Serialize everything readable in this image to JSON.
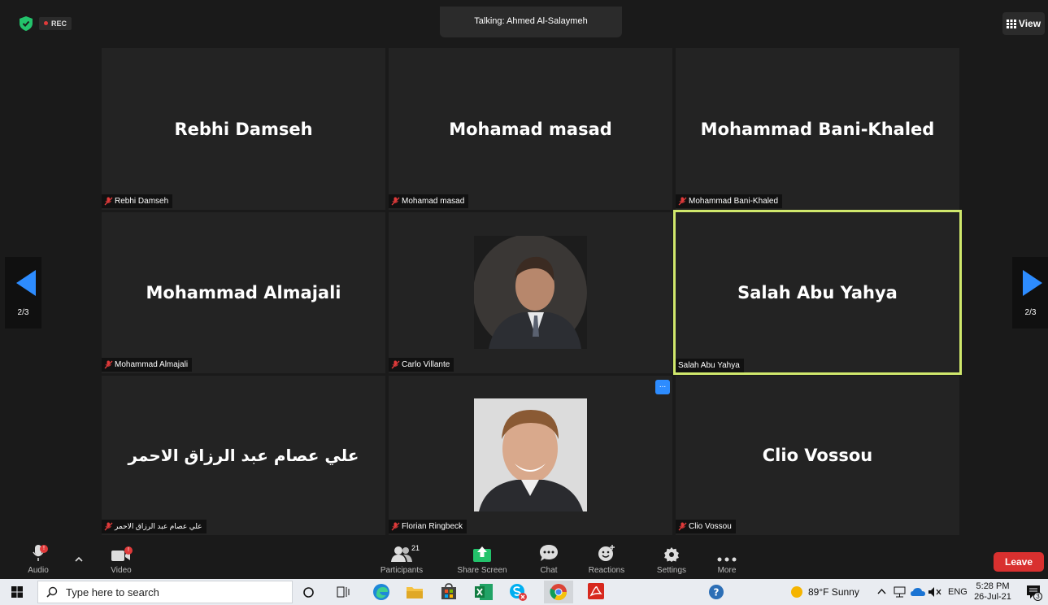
{
  "topbar": {
    "rec_label": "REC",
    "talking": "Talking: Ahmed Al-Salaymeh",
    "view_label": "View"
  },
  "tiles": [
    {
      "display_name": "Rebhi Damseh",
      "tag": "Rebhi Damseh",
      "muted": true
    },
    {
      "display_name": "Mohamad masad",
      "tag": "Mohamad masad",
      "muted": true
    },
    {
      "display_name": "Mohammad Bani-Khaled",
      "tag": "Mohammad Bani-Khaled",
      "muted": true
    },
    {
      "display_name": "Mohammad Almajali",
      "tag": "Mohammad Almajali",
      "muted": true
    },
    {
      "display_name": "",
      "tag": "Carlo Villante",
      "muted": true,
      "photo": true
    },
    {
      "display_name": "Salah Abu Yahya",
      "tag": "Salah Abu Yahya",
      "muted": false,
      "active": true
    },
    {
      "display_name": "علي عصام عبد الرزاق الاحمر",
      "tag": "علي عصام عبد الرزاق الاحمر",
      "muted": true
    },
    {
      "display_name": "",
      "tag": "Florian Ringbeck",
      "muted": true,
      "photo": true
    },
    {
      "display_name": "Clio Vossou",
      "tag": "Clio Vossou",
      "muted": true
    }
  ],
  "more_options_label": "...",
  "pager": {
    "left_label": "2/3",
    "right_label": "2/3"
  },
  "toolbar": {
    "audio_label": "Audio",
    "audio_badge": "!",
    "video_label": "Video",
    "video_badge": "!",
    "participants_label": "Participants",
    "participants_count": "21",
    "share_label": "Share Screen",
    "chat_label": "Chat",
    "reactions_label": "Reactions",
    "settings_label": "Settings",
    "more_label": "More",
    "leave_label": "Leave"
  },
  "taskbar": {
    "search_placeholder": "Type here to search",
    "weather": "89°F  Sunny",
    "language": "ENG",
    "time": "5:28 PM",
    "date": "26-Jul-21",
    "notif_count": "3"
  },
  "colors": {
    "background": "#1a1a1a",
    "tile": "#232323",
    "active_border": "#d0e86c",
    "leave": "#d9302f",
    "accent_blue": "#2d8cff",
    "muted_red": "#e03a3a"
  }
}
